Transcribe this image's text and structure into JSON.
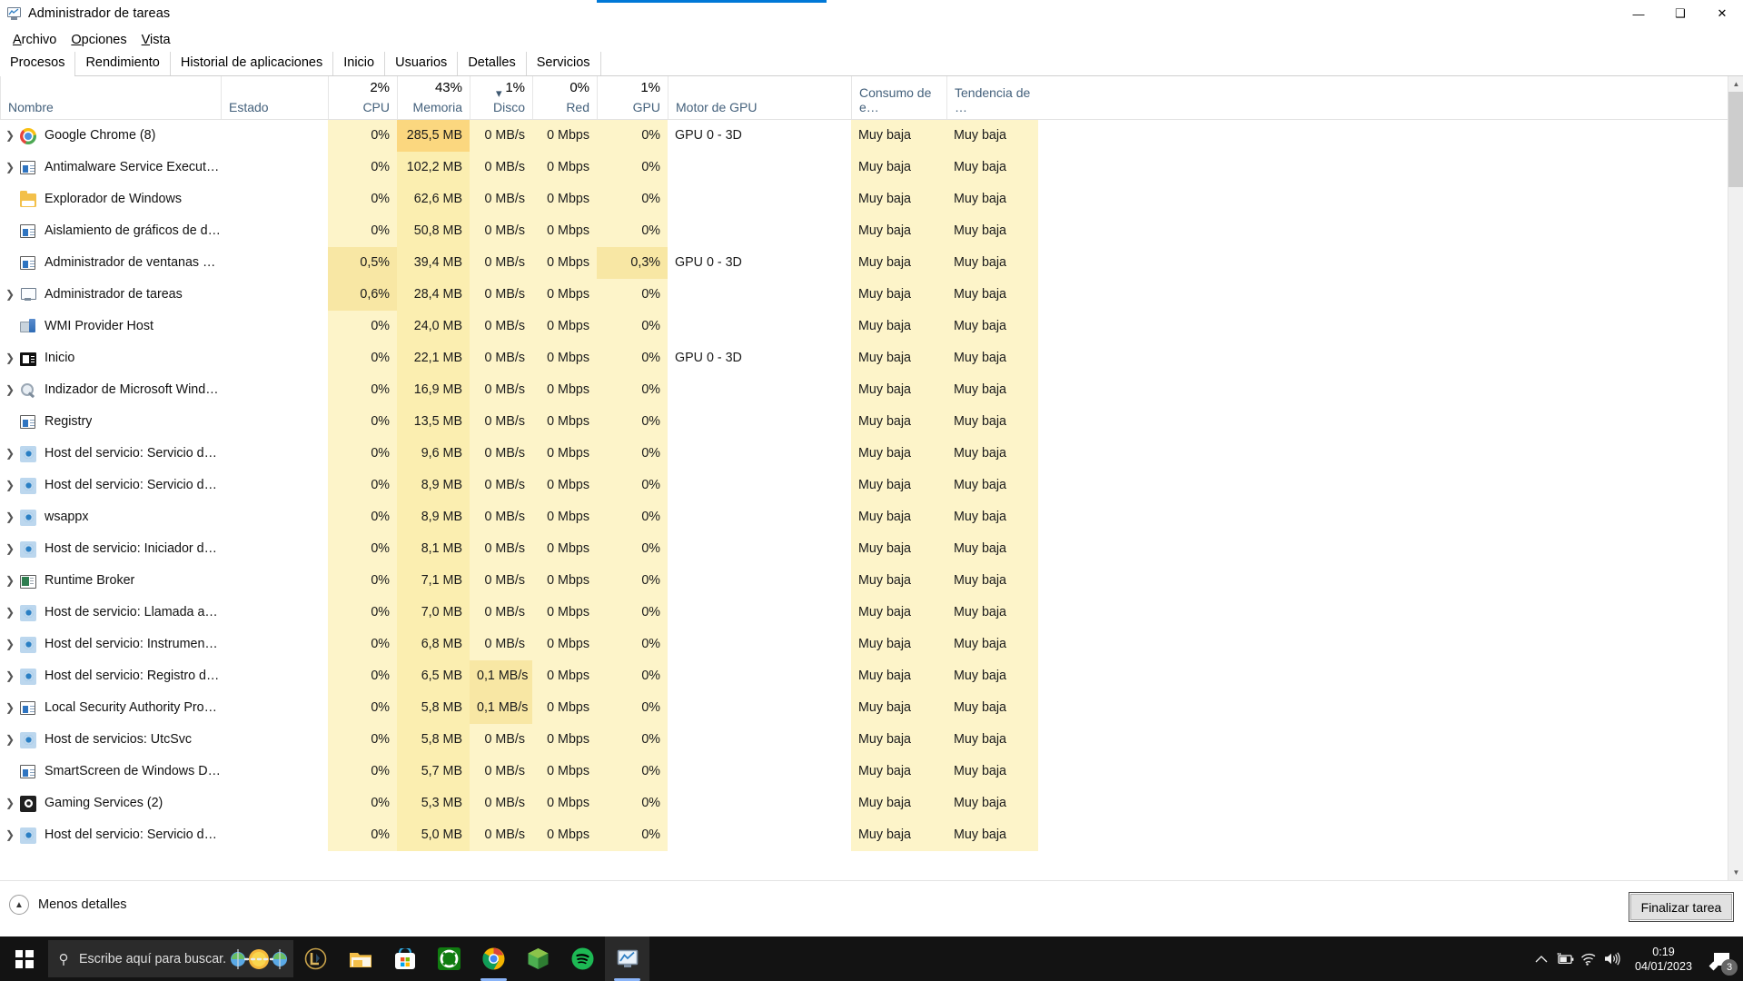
{
  "window": {
    "title": "Administrador de tareas",
    "icon": "task-manager-icon",
    "minimize": "—",
    "maximize": "❑",
    "close": "✕"
  },
  "menu": [
    {
      "label": "Archivo"
    },
    {
      "label": "Opciones"
    },
    {
      "label": "Vista"
    }
  ],
  "tabs": [
    {
      "label": "Procesos",
      "active": true
    },
    {
      "label": "Rendimiento",
      "active": false
    },
    {
      "label": "Historial de aplicaciones",
      "active": false
    },
    {
      "label": "Inicio",
      "active": false
    },
    {
      "label": "Usuarios",
      "active": false
    },
    {
      "label": "Detalles",
      "active": false
    },
    {
      "label": "Servicios",
      "active": false
    }
  ],
  "columns": [
    {
      "label": "Nombre",
      "summary": "",
      "align": "left"
    },
    {
      "label": "Estado",
      "summary": "",
      "align": "left"
    },
    {
      "label": "CPU",
      "summary": "2%",
      "align": "right"
    },
    {
      "label": "Memoria",
      "summary": "43%",
      "align": "right",
      "sorted": "desc"
    },
    {
      "label": "Disco",
      "summary": "1%",
      "align": "right"
    },
    {
      "label": "Red",
      "summary": "0%",
      "align": "right"
    },
    {
      "label": "GPU",
      "summary": "1%",
      "align": "right"
    },
    {
      "label": "Motor de GPU",
      "summary": "",
      "align": "left"
    },
    {
      "label": "Consumo de e…",
      "summary": "",
      "align": "left"
    },
    {
      "label": "Tendencia de …",
      "summary": "",
      "align": "left"
    }
  ],
  "processes": [
    {
      "expand": true,
      "icon": "chrome-icon",
      "name": "Google Chrome (8)",
      "estado": "",
      "cpu": "0%",
      "memoria": "285,5 MB",
      "disco": "0 MB/s",
      "red": "0 Mbps",
      "gpu": "0%",
      "motor_gpu": "GPU 0 - 3D",
      "consumo": "Muy baja",
      "tendencia": "Muy baja"
    },
    {
      "expand": true,
      "icon": "app-window-icon",
      "name": "Antimalware Service Executable",
      "estado": "",
      "cpu": "0%",
      "memoria": "102,2 MB",
      "disco": "0 MB/s",
      "red": "0 Mbps",
      "gpu": "0%",
      "motor_gpu": "",
      "consumo": "Muy baja",
      "tendencia": "Muy baja"
    },
    {
      "expand": false,
      "icon": "folder-icon",
      "name": "Explorador de Windows",
      "estado": "",
      "cpu": "0%",
      "memoria": "62,6 MB",
      "disco": "0 MB/s",
      "red": "0 Mbps",
      "gpu": "0%",
      "motor_gpu": "",
      "consumo": "Muy baja",
      "tendencia": "Muy baja"
    },
    {
      "expand": false,
      "icon": "app-window-icon",
      "name": "Aislamiento de gráficos de disp…",
      "estado": "",
      "cpu": "0%",
      "memoria": "50,8 MB",
      "disco": "0 MB/s",
      "red": "0 Mbps",
      "gpu": "0%",
      "motor_gpu": "",
      "consumo": "Muy baja",
      "tendencia": "Muy baja"
    },
    {
      "expand": false,
      "icon": "app-window-icon",
      "name": "Administrador de ventanas del …",
      "estado": "",
      "cpu": "0,5%",
      "memoria": "39,4 MB",
      "disco": "0 MB/s",
      "red": "0 Mbps",
      "gpu": "0,3%",
      "motor_gpu": "GPU 0 - 3D",
      "consumo": "Muy baja",
      "tendencia": "Muy baja"
    },
    {
      "expand": true,
      "icon": "task-manager-icon",
      "name": "Administrador de tareas",
      "estado": "",
      "cpu": "0,6%",
      "memoria": "28,4 MB",
      "disco": "0 MB/s",
      "red": "0 Mbps",
      "gpu": "0%",
      "motor_gpu": "",
      "consumo": "Muy baja",
      "tendencia": "Muy baja"
    },
    {
      "expand": false,
      "icon": "wmi-icon",
      "name": "WMI Provider Host",
      "estado": "",
      "cpu": "0%",
      "memoria": "24,0 MB",
      "disco": "0 MB/s",
      "red": "0 Mbps",
      "gpu": "0%",
      "motor_gpu": "",
      "consumo": "Muy baja",
      "tendencia": "Muy baja"
    },
    {
      "expand": true,
      "icon": "dark-window-icon",
      "name": "Inicio",
      "estado": "",
      "cpu": "0%",
      "memoria": "22,1 MB",
      "disco": "0 MB/s",
      "red": "0 Mbps",
      "gpu": "0%",
      "motor_gpu": "GPU 0 - 3D",
      "consumo": "Muy baja",
      "tendencia": "Muy baja"
    },
    {
      "expand": true,
      "icon": "magnifier-icon",
      "name": "Indizador de Microsoft Window…",
      "estado": "",
      "cpu": "0%",
      "memoria": "16,9 MB",
      "disco": "0 MB/s",
      "red": "0 Mbps",
      "gpu": "0%",
      "motor_gpu": "",
      "consumo": "Muy baja",
      "tendencia": "Muy baja"
    },
    {
      "expand": false,
      "icon": "app-window-icon",
      "name": "Registry",
      "estado": "",
      "cpu": "0%",
      "memoria": "13,5 MB",
      "disco": "0 MB/s",
      "red": "0 Mbps",
      "gpu": "0%",
      "motor_gpu": "",
      "consumo": "Muy baja",
      "tendencia": "Muy baja"
    },
    {
      "expand": true,
      "icon": "gear-icon",
      "name": "Host del servicio: Servicio de dir…",
      "estado": "",
      "cpu": "0%",
      "memoria": "9,6 MB",
      "disco": "0 MB/s",
      "red": "0 Mbps",
      "gpu": "0%",
      "motor_gpu": "",
      "consumo": "Muy baja",
      "tendencia": "Muy baja"
    },
    {
      "expand": true,
      "icon": "gear-icon",
      "name": "Host del servicio: Servicio de re…",
      "estado": "",
      "cpu": "0%",
      "memoria": "8,9 MB",
      "disco": "0 MB/s",
      "red": "0 Mbps",
      "gpu": "0%",
      "motor_gpu": "",
      "consumo": "Muy baja",
      "tendencia": "Muy baja"
    },
    {
      "expand": true,
      "icon": "gear-icon",
      "name": "wsappx",
      "estado": "",
      "cpu": "0%",
      "memoria": "8,9 MB",
      "disco": "0 MB/s",
      "red": "0 Mbps",
      "gpu": "0%",
      "motor_gpu": "",
      "consumo": "Muy baja",
      "tendencia": "Muy baja"
    },
    {
      "expand": true,
      "icon": "gear-icon",
      "name": "Host de servicio: Iniciador de pr…",
      "estado": "",
      "cpu": "0%",
      "memoria": "8,1 MB",
      "disco": "0 MB/s",
      "red": "0 Mbps",
      "gpu": "0%",
      "motor_gpu": "",
      "consumo": "Muy baja",
      "tendencia": "Muy baja"
    },
    {
      "expand": true,
      "icon": "runtime-broker-icon",
      "name": "Runtime Broker",
      "estado": "",
      "cpu": "0%",
      "memoria": "7,1 MB",
      "disco": "0 MB/s",
      "red": "0 Mbps",
      "gpu": "0%",
      "motor_gpu": "",
      "consumo": "Muy baja",
      "tendencia": "Muy baja"
    },
    {
      "expand": true,
      "icon": "gear-icon",
      "name": "Host de servicio: Llamada a pro…",
      "estado": "",
      "cpu": "0%",
      "memoria": "7,0 MB",
      "disco": "0 MB/s",
      "red": "0 Mbps",
      "gpu": "0%",
      "motor_gpu": "",
      "consumo": "Muy baja",
      "tendencia": "Muy baja"
    },
    {
      "expand": true,
      "icon": "gear-icon",
      "name": "Host del servicio: Instrumental d…",
      "estado": "",
      "cpu": "0%",
      "memoria": "6,8 MB",
      "disco": "0 MB/s",
      "red": "0 Mbps",
      "gpu": "0%",
      "motor_gpu": "",
      "consumo": "Muy baja",
      "tendencia": "Muy baja"
    },
    {
      "expand": true,
      "icon": "gear-icon",
      "name": "Host del servicio: Registro de ev…",
      "estado": "",
      "cpu": "0%",
      "memoria": "6,5 MB",
      "disco": "0,1 MB/s",
      "red": "0 Mbps",
      "gpu": "0%",
      "motor_gpu": "",
      "consumo": "Muy baja",
      "tendencia": "Muy baja"
    },
    {
      "expand": true,
      "icon": "app-window-icon",
      "name": "Local Security Authority Process …",
      "estado": "",
      "cpu": "0%",
      "memoria": "5,8 MB",
      "disco": "0,1 MB/s",
      "red": "0 Mbps",
      "gpu": "0%",
      "motor_gpu": "",
      "consumo": "Muy baja",
      "tendencia": "Muy baja"
    },
    {
      "expand": true,
      "icon": "gear-icon",
      "name": "Host de servicios: UtcSvc",
      "estado": "",
      "cpu": "0%",
      "memoria": "5,8 MB",
      "disco": "0 MB/s",
      "red": "0 Mbps",
      "gpu": "0%",
      "motor_gpu": "",
      "consumo": "Muy baja",
      "tendencia": "Muy baja"
    },
    {
      "expand": false,
      "icon": "app-window-icon",
      "name": "SmartScreen de Windows Defen…",
      "estado": "",
      "cpu": "0%",
      "memoria": "5,7 MB",
      "disco": "0 MB/s",
      "red": "0 Mbps",
      "gpu": "0%",
      "motor_gpu": "",
      "consumo": "Muy baja",
      "tendencia": "Muy baja"
    },
    {
      "expand": true,
      "icon": "xbox-icon",
      "name": "Gaming Services (2)",
      "estado": "",
      "cpu": "0%",
      "memoria": "5,3 MB",
      "disco": "0 MB/s",
      "red": "0 Mbps",
      "gpu": "0%",
      "motor_gpu": "",
      "consumo": "Muy baja",
      "tendencia": "Muy baja"
    },
    {
      "expand": true,
      "icon": "gear-icon",
      "name": "Host del servicio: Servicio de us…",
      "estado": "",
      "cpu": "0%",
      "memoria": "5,0 MB",
      "disco": "0 MB/s",
      "red": "0 Mbps",
      "gpu": "0%",
      "motor_gpu": "",
      "consumo": "Muy baja",
      "tendencia": "Muy baja"
    }
  ],
  "statusbar": {
    "less_details": "Menos detalles",
    "end_task": "Finalizar tarea"
  },
  "taskbar": {
    "start_icon": "windows-start-icon",
    "search_placeholder": "Escribe aquí para buscar.",
    "search_icon": "search-icon",
    "items": [
      {
        "icon": "league-of-legends-icon"
      },
      {
        "icon": "file-explorer-icon"
      },
      {
        "icon": "microsoft-store-icon"
      },
      {
        "icon": "xbox-icon"
      },
      {
        "icon": "chrome-icon",
        "active": false
      },
      {
        "icon": "package-icon"
      },
      {
        "icon": "spotify-icon"
      },
      {
        "icon": "task-manager-icon",
        "active": true
      }
    ],
    "tray": [
      {
        "icon": "chevron-up-icon"
      },
      {
        "icon": "battery-charging-icon"
      },
      {
        "icon": "wifi-icon"
      },
      {
        "icon": "volume-icon"
      }
    ],
    "clock_time": "0:19",
    "clock_date": "04/01/2023",
    "notification_count": "3",
    "notification_icon": "notification-icon"
  },
  "colors": {
    "heat_base": "#fdf4c9",
    "heat_memory_col": "#fbeeb0",
    "heat_hot": "#fbd77f",
    "heat_mid": "#f8e7a4",
    "accent": "#0078d7",
    "taskbar_bg": "#131313"
  }
}
